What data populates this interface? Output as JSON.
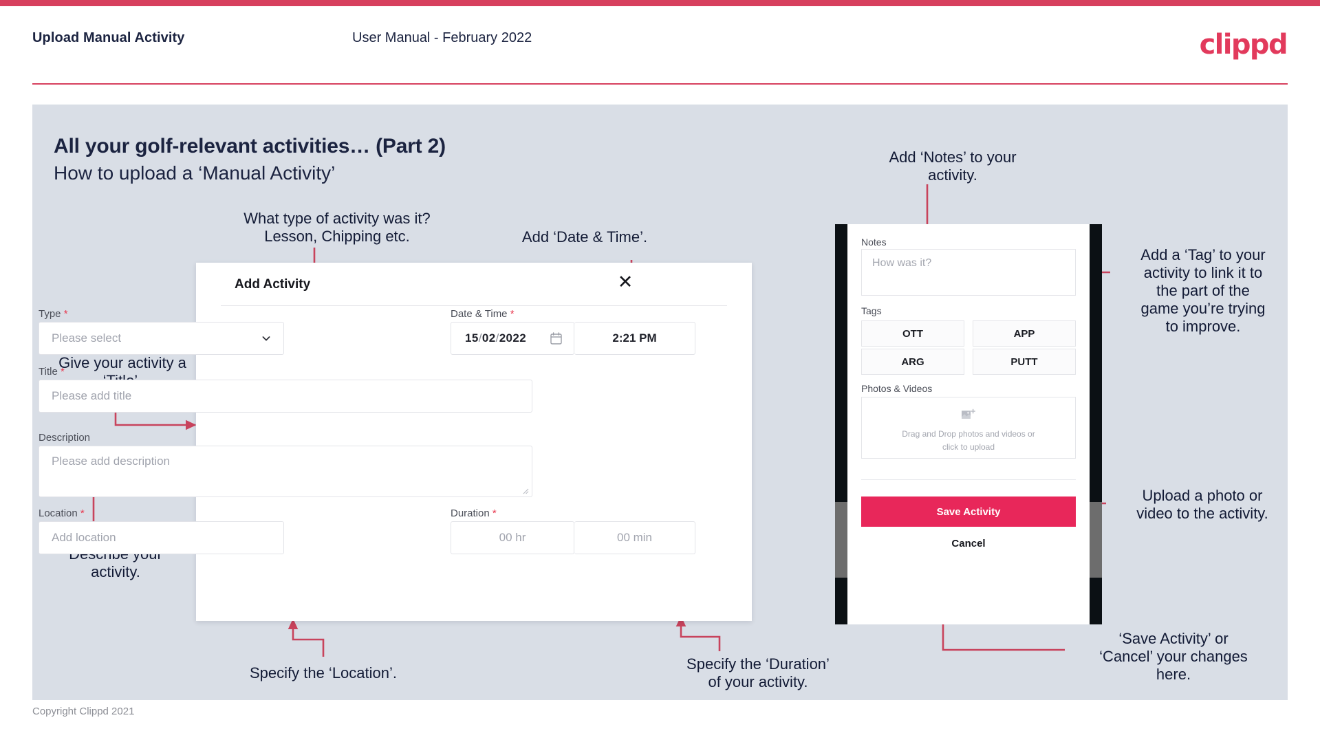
{
  "header": {
    "title": "Upload Manual Activity",
    "subtitle": "User Manual - February 2022",
    "brand": "clippd"
  },
  "slide": {
    "title": "All your golf-relevant activities… (Part 2)",
    "subtitle": "How to upload a ‘Manual Activity’"
  },
  "footer": {
    "copyright": "Copyright Clippd 2021"
  },
  "dialog": {
    "title": "Add Activity",
    "close_icon": "close-icon",
    "fields": {
      "type": {
        "label": "Type",
        "required": "*",
        "placeholder": "Please select",
        "chevron_icon": "chevron-down-icon"
      },
      "datetime": {
        "label": "Date & Time",
        "required": "*",
        "day": "15",
        "month": "02",
        "year": "2022",
        "sep": "/",
        "calendar_icon": "calendar-icon",
        "time": "2:21 PM"
      },
      "title": {
        "label": "Title",
        "required": "*",
        "placeholder": "Please add title"
      },
      "description": {
        "label": "Description",
        "required": "",
        "placeholder": "Please add description"
      },
      "location": {
        "label": "Location",
        "required": "*",
        "placeholder": "Add location"
      },
      "duration": {
        "label": "Duration",
        "required": "*",
        "hours": "00 hr",
        "minutes": "00 min"
      }
    }
  },
  "phone": {
    "notes": {
      "label": "Notes",
      "placeholder": "How was it?"
    },
    "tags": {
      "label": "Tags",
      "items": [
        "OTT",
        "APP",
        "ARG",
        "PUTT"
      ]
    },
    "photos": {
      "label": "Photos & Videos",
      "icon": "add-image-icon",
      "dropzone_line1": "Drag and Drop photos and videos or",
      "dropzone_line2": "click to upload"
    },
    "save_label": "Save Activity",
    "cancel_label": "Cancel"
  },
  "annotations": {
    "type": "What type of activity was it?\nLesson, Chipping etc.",
    "datetime": "Add ‘Date & Time’.",
    "title": "Give your activity a\n‘Title’.",
    "description": "Describe your\nactivity.",
    "location": "Specify the ‘Location’.",
    "duration": "Specify the ‘Duration’\nof your activity.",
    "notes": "Add ‘Notes’ to your\nactivity.",
    "tags": "Add a ‘Tag’ to your\nactivity to link it to\nthe part of the\ngame you’re trying\nto improve.",
    "upload": "Upload a photo or\nvideo to the activity.",
    "save": "‘Save Activity’ or\n‘Cancel’ your changes\nhere."
  },
  "colors": {
    "brand": "#e23a5c",
    "accent": "#d7405e",
    "save_button": "#e8275a",
    "slide_bg": "#d9dee6",
    "text_dark": "#1b2340"
  }
}
